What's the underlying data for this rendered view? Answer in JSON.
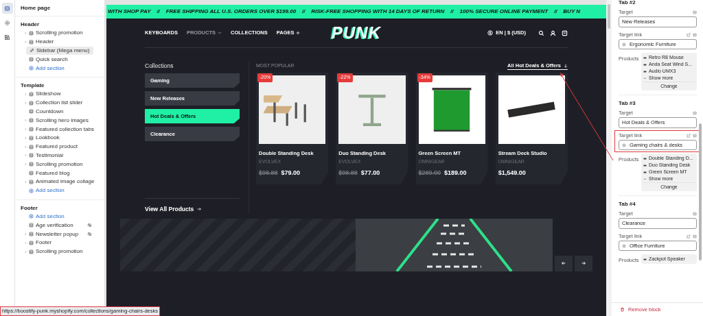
{
  "rail": [
    {
      "selected": true
    },
    {
      "selected": false
    },
    {
      "selected": false
    }
  ],
  "sidebar": {
    "title": "Home page",
    "groups": [
      {
        "heading": "Header",
        "items": [
          {
            "kind": "section",
            "label": "Scrolling promotion",
            "expanded": false,
            "selected": false,
            "hidden": false
          },
          {
            "kind": "section",
            "label": "Header",
            "expanded": true,
            "selected": false,
            "hidden": false,
            "children": [
              {
                "kind": "plain",
                "label": "Sidebar (Mega menu)",
                "selected": true,
                "hidden": false
              }
            ]
          },
          {
            "kind": "plain",
            "label": "Quick search",
            "selected": false,
            "hidden": false
          },
          {
            "kind": "add",
            "label": "Add section"
          }
        ]
      },
      {
        "heading": "Template",
        "items": [
          {
            "kind": "section",
            "label": "Slideshow",
            "expanded": false,
            "selected": false,
            "hidden": false
          },
          {
            "kind": "section",
            "label": "Collection list slider",
            "expanded": false,
            "selected": false,
            "hidden": false
          },
          {
            "kind": "plain",
            "label": "Countdown",
            "selected": false,
            "hidden": false
          },
          {
            "kind": "section",
            "label": "Scrolling hero images",
            "expanded": false,
            "selected": false,
            "hidden": false
          },
          {
            "kind": "section",
            "label": "Featured collection tabs",
            "expanded": false,
            "selected": false,
            "hidden": false
          },
          {
            "kind": "section",
            "label": "Lookbook",
            "expanded": false,
            "selected": false,
            "hidden": false
          },
          {
            "kind": "section",
            "label": "Featured product",
            "expanded": false,
            "selected": false,
            "hidden": false
          },
          {
            "kind": "section",
            "label": "Testimonial",
            "expanded": false,
            "selected": false,
            "hidden": false
          },
          {
            "kind": "section",
            "label": "Scrolling promotion",
            "expanded": false,
            "selected": false,
            "hidden": false
          },
          {
            "kind": "plain",
            "label": "Featured blog",
            "selected": false,
            "hidden": false
          },
          {
            "kind": "section",
            "label": "Animated image collage",
            "expanded": false,
            "selected": false,
            "hidden": false
          },
          {
            "kind": "add",
            "label": "Add section"
          }
        ]
      },
      {
        "heading": "Footer",
        "items": [
          {
            "kind": "add",
            "label": "Add section"
          },
          {
            "kind": "plain",
            "label": "Age verification",
            "selected": false,
            "hidden": true
          },
          {
            "kind": "section",
            "label": "Newsletter popup",
            "expanded": false,
            "selected": false,
            "hidden": true
          },
          {
            "kind": "section",
            "label": "Footer",
            "expanded": false,
            "selected": false,
            "hidden": false
          },
          {
            "kind": "section",
            "label": "Scrolling promotion",
            "expanded": false,
            "selected": false,
            "hidden": false
          }
        ]
      }
    ]
  },
  "preview": {
    "announcement": [
      {
        "kind": "message",
        "text": "WITH SHOP PAY"
      },
      {
        "kind": "separator",
        "text": "//"
      },
      {
        "kind": "message",
        "text": "FREE SHIPPING ALL U.S. ORDERS OVER $199.00"
      },
      {
        "kind": "separator",
        "text": "//"
      },
      {
        "kind": "message",
        "text": "RISK-FREE SHOPPING WITH 14 DAYS OF RETURN"
      },
      {
        "kind": "separator",
        "text": "//"
      },
      {
        "kind": "message",
        "text": "100% SECURE ONLINE PAYMENT"
      },
      {
        "kind": "separator",
        "text": "//"
      },
      {
        "kind": "message",
        "text": "BUY N"
      }
    ],
    "nav": [
      {
        "kind": "link",
        "label": "KEYBOARDS"
      },
      {
        "kind": "dropdown",
        "label": "PRODUCTS",
        "expanded": true
      },
      {
        "kind": "link",
        "label": "COLLECTIONS"
      },
      {
        "kind": "dropdown",
        "label": "PAGES",
        "expanded": false
      }
    ],
    "logo": "PUNK",
    "locale": "EN | $ (USD)",
    "collections": {
      "heading": "Collections",
      "tabs": [
        {
          "label": "Gaming",
          "selected": false
        },
        {
          "label": "New Releases",
          "selected": false
        },
        {
          "label": "Hot Deals & Offers",
          "selected": true
        },
        {
          "label": "Clearance",
          "selected": false
        }
      ],
      "view_all": "View All Products"
    },
    "products": {
      "label": "MOST POPULAR",
      "link": "All Hot Deals & Offers",
      "items": [
        {
          "kind": "desk",
          "badge": "-20%",
          "name": "Double Standing Desk",
          "vendor": "EVOLVEX",
          "compare_price": "$98.88",
          "price": "$79.00"
        },
        {
          "kind": "standing-desk",
          "badge": "-22%",
          "name": "Duo Standing Desk",
          "vendor": "EVOLVEX",
          "compare_price": "$98.88",
          "price": "$77.00"
        },
        {
          "kind": "green-screen",
          "badge": "-34%",
          "name": "Green Screen MT",
          "vendor": "OMNIGEAR",
          "compare_price": "$289.00",
          "price": "$189.00"
        },
        {
          "kind": "panel",
          "name": "Stream Deck Studio",
          "vendor": "OMNIGEAR",
          "price": "$1,549.00"
        }
      ]
    }
  },
  "settings": {
    "blocks": [
      {
        "heading": "Tab #2",
        "target_label": "Target",
        "target": "New Releases",
        "link_label": "Target link",
        "link": "Ergonomic Furniture",
        "link_highlighted": false,
        "products_label": "Products",
        "products": [
          "Retro R8 Mouse",
          "Anda Seat Wind S...",
          "Audio UMX3"
        ],
        "show_more": "Show more",
        "change": "Change"
      },
      {
        "heading": "Tab #3",
        "target_label": "Target",
        "target": "Hot Deals & Offers",
        "link_label": "Target link",
        "link": "Gaming chairs & desks",
        "link_highlighted": true,
        "products_label": "Products",
        "products": [
          "Double Standing D...",
          "Duo Standing Desk",
          "Green Screen MT"
        ],
        "show_more": "Show more",
        "change": "Change"
      },
      {
        "heading": "Tab #4",
        "target_label": "Target",
        "target": "Clearance",
        "link_label": "Target link",
        "link": "Office Furniture",
        "link_highlighted": false,
        "products_label": "Products",
        "products": [
          "Zackpot Speaker"
        ]
      }
    ],
    "remove": "Remove block"
  },
  "status_bar": {
    "url": "https://boostify-punk.myshopify.com/collections/gaming-chairs-desks",
    "highlighted": true
  }
}
